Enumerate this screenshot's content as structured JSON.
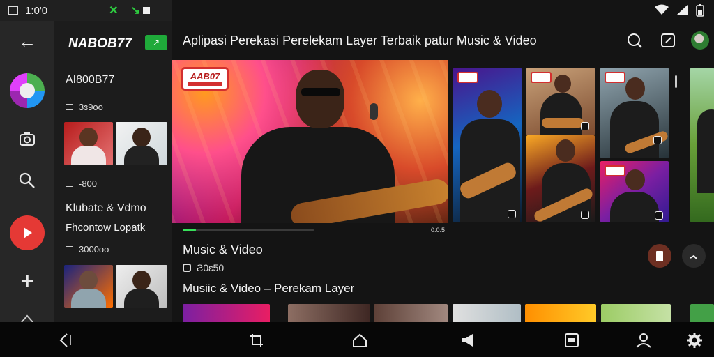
{
  "status_bar": {
    "time": "1:0'0"
  },
  "panel": {
    "brand": "NABOB77",
    "channel_name": "AI800B77",
    "views_1": "3ɜ9oo",
    "views_2": "-800",
    "section_title": "Klubate & Vdmo",
    "section_subtitle": "Fhcontow Lopatk",
    "views_3": "3000oo"
  },
  "header": {
    "title": "Aplipasi Perekasi Perelekam Layer Terbaik patur Music & Video"
  },
  "hero": {
    "badge_text": "AAB07",
    "progress_percent": 10,
    "duration": "0:0:5"
  },
  "section": {
    "title": "Music & Video",
    "meta": "Ƨ0ɛ50",
    "subtitle": "Musiic & Video – Perekam Layer"
  },
  "colors": {
    "accent_green": "#2ecc40",
    "play_red": "#e53935",
    "badge_red": "#d32f2f"
  },
  "icons": {
    "rail": [
      "back-arrow-icon",
      "app-logo-icon",
      "camera-icon",
      "magnify-icon",
      "play-icon",
      "plus-icon",
      "filter-icon"
    ],
    "toolbar": [
      "search-icon",
      "edit-icon",
      "avatar-icon"
    ],
    "nav": [
      "back-icon",
      "crop-icon",
      "home-icon",
      "volume-icon",
      "recents-icon",
      "account-icon",
      "settings-icon"
    ]
  }
}
